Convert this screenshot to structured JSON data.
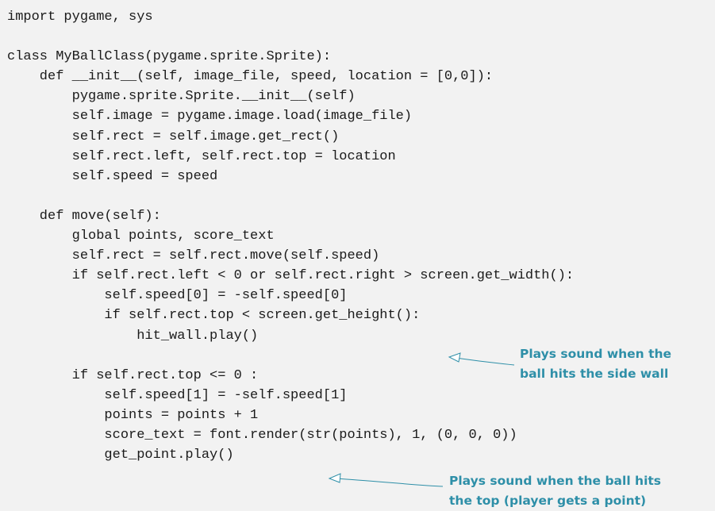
{
  "code_lines": [
    "import pygame, sys",
    "",
    "class MyBallClass(pygame.sprite.Sprite):",
    "    def __init__(self, image_file, speed, location = [0,0]):",
    "        pygame.sprite.Sprite.__init__(self)",
    "        self.image = pygame.image.load(image_file)",
    "        self.rect = self.image.get_rect()",
    "        self.rect.left, self.rect.top = location",
    "        self.speed = speed",
    "",
    "    def move(self):",
    "        global points, score_text",
    "        self.rect = self.rect.move(self.speed)",
    "        if self.rect.left < 0 or self.rect.right > screen.get_width():",
    "            self.speed[0] = -self.speed[0]",
    "            if self.rect.top < screen.get_height():",
    "                hit_wall.play()",
    "",
    "        if self.rect.top <= 0 :",
    "            self.speed[1] = -self.speed[1]",
    "            points = points + 1",
    "            score_text = font.render(str(points), 1, (0, 0, 0))",
    "            get_point.play()"
  ],
  "annotations": {
    "side_wall": {
      "line1": "Plays sound when the",
      "line2": "ball hits the side wall"
    },
    "top_point": {
      "line1": "Plays sound when the ball hits",
      "line2": "the top (player gets a point)"
    }
  },
  "colors": {
    "background": "#f2f2f2",
    "code_text": "#1a1a1a",
    "annotation": "#2e8fa8"
  }
}
